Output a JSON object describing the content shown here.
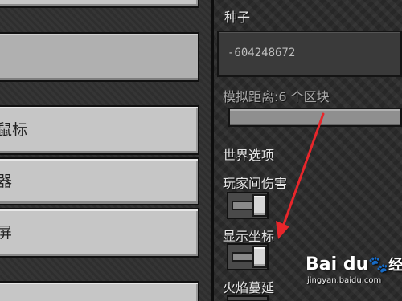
{
  "left_buttons": [
    {
      "label": ""
    },
    {
      "label": ""
    },
    {
      "label": "鼠标"
    },
    {
      "label": "器"
    },
    {
      "label": "屏"
    },
    {
      "label": ""
    }
  ],
  "right": {
    "seed_label": "种子",
    "seed_value": "-604248672",
    "sim_distance_label": "模拟距离:6 个区块",
    "world_options_label": "世界选项",
    "pvp_label": "玩家间伤害",
    "show_coords_label": "显示坐标",
    "fire_spread_label": "火焰蔓延",
    "pvp_enabled": true,
    "show_coords_enabled": true
  },
  "watermark": {
    "logo": "Bai du",
    "suffix": "经验",
    "url": "jingyan.baidu.com"
  },
  "colors": {
    "arrow": "#e8262b"
  }
}
